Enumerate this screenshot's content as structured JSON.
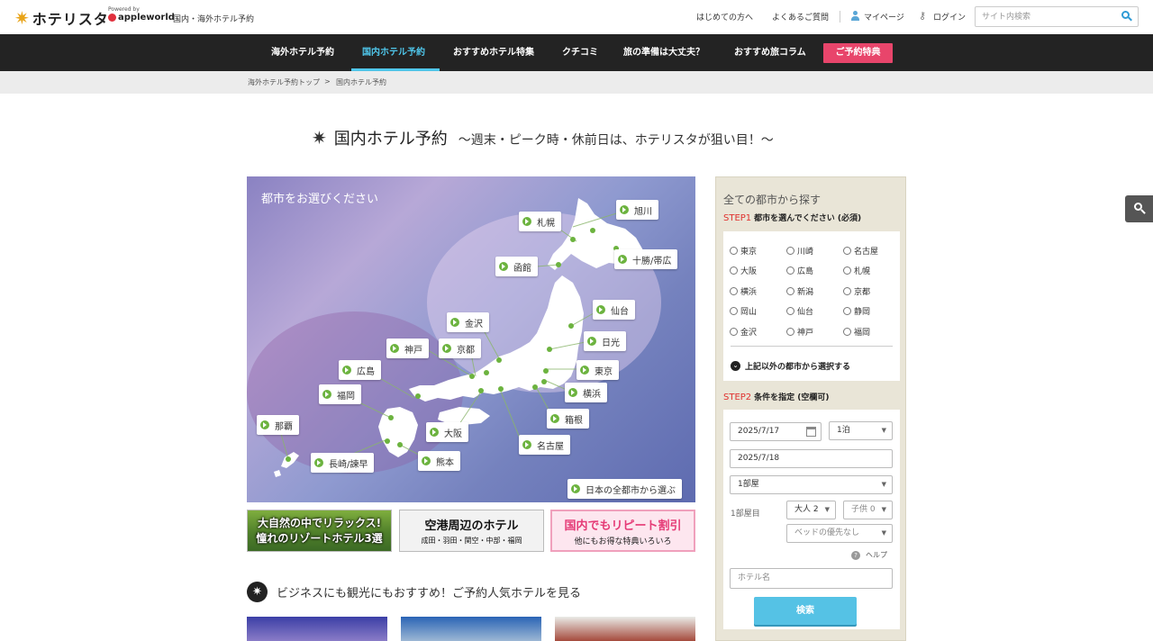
{
  "header": {
    "logo_text": "ホテリスタ",
    "powered_by": "Powered by",
    "brand": "appleworld",
    "tagline": "国内・海外ホテル予約",
    "links": [
      "はじめての方へ",
      "よくあるご質問",
      "マイページ",
      "ログイン"
    ],
    "search_placeholder": "サイト内検索"
  },
  "nav": {
    "items": [
      "海外ホテル予約",
      "国内ホテル予約",
      "おすすめホテル特集",
      "クチコミ",
      "旅の準備は大丈夫？",
      "おすすめ旅コラム"
    ],
    "active_index": 1,
    "special": "ご予約特典",
    "accent_color": "#4fc6ea",
    "special_color": "#e8456b"
  },
  "breadcrumb": [
    "海外ホテル予約トップ",
    ">",
    "国内ホテル予約"
  ],
  "title": {
    "main": "国内ホテル予約",
    "sub": "～週末・ピーク時・休前日は、ホテリスタが狙い目！～"
  },
  "map": {
    "heading": "都市をお選びください",
    "cities": [
      "旭川",
      "札幌",
      "十勝/帯広",
      "函館",
      "仙台",
      "金沢",
      "日光",
      "神戸",
      "京都",
      "東京",
      "広島",
      "横浜",
      "福岡",
      "箱根",
      "那覇",
      "大阪",
      "名古屋",
      "長崎/諫早",
      "熊本"
    ],
    "all_cities": "日本の全都市から選ぶ"
  },
  "banners": [
    {
      "l1": "大自然の中でリラックス!",
      "l2": "憧れのリゾートホテル3選"
    },
    {
      "l1": "空港周辺のホテル",
      "l2": "成田・羽田・関空・中部・福岡"
    },
    {
      "l1": "国内でもリピート割引",
      "l2": "他にもお得な特典いろいろ"
    }
  ],
  "section": {
    "heading": "ビジネスにも観光にもおすすめ！ご予約人気ホテルを見る"
  },
  "panel": {
    "heading": "全ての都市から探す",
    "step1_num": "STEP1",
    "step1_text": "都市を選んでください (必須)",
    "cities": [
      "東京",
      "川崎",
      "名古屋",
      "大阪",
      "広島",
      "札幌",
      "横浜",
      "新潟",
      "京都",
      "岡山",
      "仙台",
      "静岡",
      "金沢",
      "神戸",
      "福岡"
    ],
    "more": "上記以外の都市から選択する",
    "step2_num": "STEP2",
    "step2_text": "条件を指定 (空欄可)",
    "checkin": "2025/7/17",
    "nights": "1泊",
    "checkout": "2025/7/18",
    "rooms": "1部屋",
    "room_label": "1部屋目",
    "adults": "大人 2",
    "children": "子供 0",
    "bed": "ベッドの優先なし",
    "help": "ヘルプ",
    "hotel_placeholder": "ホテル名",
    "search_button": "検索"
  }
}
